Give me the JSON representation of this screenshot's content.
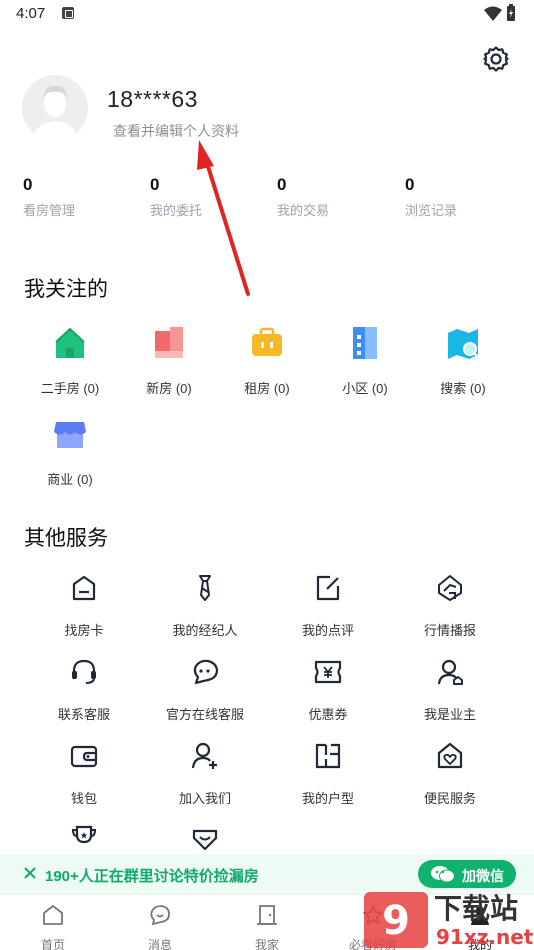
{
  "status_bar": {
    "time": "4:07"
  },
  "profile": {
    "username": "18****63",
    "edit_link": "查看并编辑个人资料"
  },
  "stats": [
    {
      "count": "0",
      "label": "看房管理"
    },
    {
      "count": "0",
      "label": "我的委托"
    },
    {
      "count": "0",
      "label": "我的交易"
    },
    {
      "count": "0",
      "label": "浏览记录"
    }
  ],
  "follow": {
    "title": "我关注的",
    "items": [
      {
        "label": "二手房 (0)",
        "icon": "house-icon",
        "color": "#1ec27c"
      },
      {
        "label": "新房 (0)",
        "icon": "building-icon",
        "color": "#f06a6a"
      },
      {
        "label": "租房 (0)",
        "icon": "suitcase-icon",
        "color": "#f5b925"
      },
      {
        "label": "小区 (0)",
        "icon": "community-icon",
        "color": "#3d8ef5"
      },
      {
        "label": "搜索 (0)",
        "icon": "search-map-icon",
        "color": "#19b6e6"
      },
      {
        "label": "商业 (0)",
        "icon": "shop-icon",
        "color": "#5b7cf5"
      }
    ]
  },
  "services": {
    "title": "其他服务",
    "items": [
      {
        "label": "找房卡",
        "icon": "card-icon"
      },
      {
        "label": "我的经纪人",
        "icon": "tie-icon"
      },
      {
        "label": "我的点评",
        "icon": "review-icon"
      },
      {
        "label": "行情播报",
        "icon": "broadcast-icon"
      },
      {
        "label": "联系客服",
        "icon": "headset-icon"
      },
      {
        "label": "官方在线客服",
        "icon": "chat-icon"
      },
      {
        "label": "优惠券",
        "icon": "coupon-icon"
      },
      {
        "label": "我是业主",
        "icon": "owner-icon"
      },
      {
        "label": "钱包",
        "icon": "wallet-icon"
      },
      {
        "label": "加入我们",
        "icon": "join-icon"
      },
      {
        "label": "我的户型",
        "icon": "floorplan-icon"
      },
      {
        "label": "便民服务",
        "icon": "heart-house-icon"
      },
      {
        "label": "",
        "icon": "trophy-icon"
      },
      {
        "label": "",
        "icon": "badge-icon"
      }
    ]
  },
  "banner": {
    "text": "190+人正在群里讨论特价捡漏房",
    "button_label": "加微信"
  },
  "tabs": [
    {
      "label": "首页",
      "icon": "home-tab-icon"
    },
    {
      "label": "消息",
      "icon": "message-tab-icon"
    },
    {
      "label": "我家",
      "icon": "door-tab-icon"
    },
    {
      "label": "必看好房",
      "icon": "star-tab-icon"
    },
    {
      "label": "我的",
      "icon": "profile-tab-icon"
    }
  ],
  "watermark": {
    "text": "下载站",
    "sub": "91xz.net"
  },
  "colors": {
    "accent_green": "#10b36e",
    "arrow_red": "#e02424",
    "text_dark": "#111111",
    "text_muted": "#9ca3af"
  }
}
